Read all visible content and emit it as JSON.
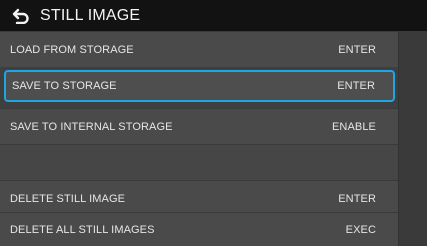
{
  "header": {
    "title": "STILL IMAGE",
    "back_icon": "return-arrow-icon"
  },
  "colors": {
    "header_bg": "#121212",
    "row_bg": "#4a4a4a",
    "selection_border": "#1ba7e6",
    "text": "#e6e6e6"
  },
  "menu": {
    "items": [
      {
        "label": "LOAD FROM STORAGE",
        "value": "ENTER"
      },
      {
        "label": "SAVE TO STORAGE",
        "value": "ENTER"
      },
      {
        "label": "SAVE TO INTERNAL STORAGE",
        "value": "ENABLE"
      },
      {
        "label": "",
        "value": ""
      },
      {
        "label": "DELETE STILL IMAGE",
        "value": "ENTER"
      },
      {
        "label": "DELETE ALL STILL IMAGES",
        "value": "EXEC"
      }
    ],
    "selected_index": 1
  }
}
